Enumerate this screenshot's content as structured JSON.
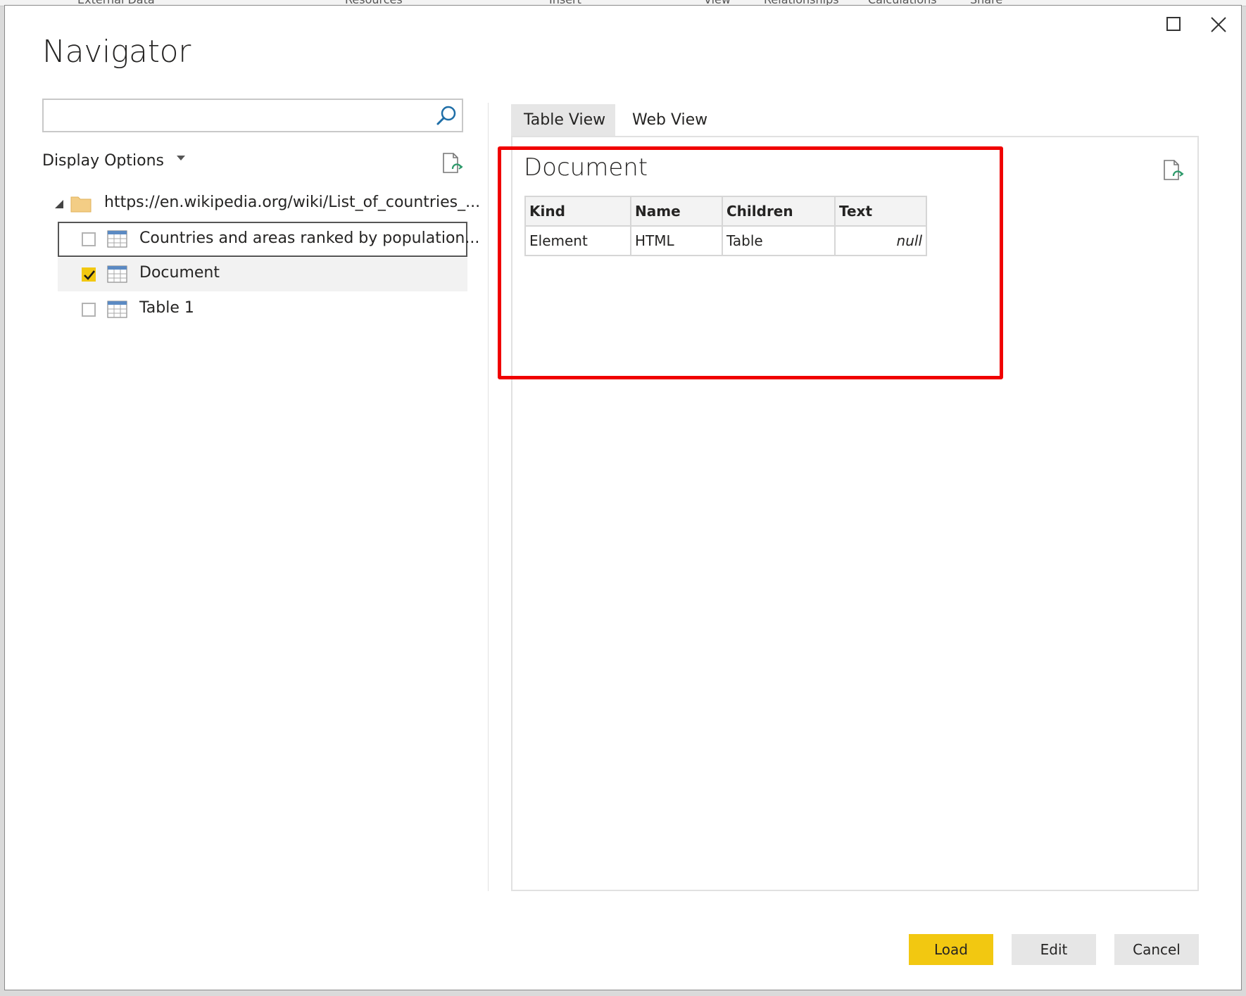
{
  "ribbon": {
    "tabs": [
      "External Data",
      "Resources",
      "Insert",
      "View",
      "Relationships",
      "Calculations",
      "Share"
    ]
  },
  "dialog": {
    "title": "Navigator",
    "maximize_icon": "maximize-icon",
    "close_icon": "close-icon"
  },
  "left_panel": {
    "search": {
      "value": "",
      "placeholder": "",
      "icon": "search-icon"
    },
    "display_options_label": "Display Options",
    "tree": {
      "root": {
        "label": "https://en.wikipedia.org/wiki/List_of_countries_...",
        "expanded": true,
        "icon": "folder-icon"
      },
      "items": [
        {
          "label": "Countries and areas ranked by population...",
          "checked": false,
          "focused": true,
          "selected": false
        },
        {
          "label": "Document",
          "checked": true,
          "focused": false,
          "selected": true
        },
        {
          "label": "Table 1",
          "checked": false,
          "focused": false,
          "selected": false
        }
      ]
    }
  },
  "right_panel": {
    "tabs": [
      {
        "label": "Table View",
        "active": true
      },
      {
        "label": "Web View",
        "active": false
      }
    ],
    "preview": {
      "title": "Document",
      "columns": [
        "Kind",
        "Name",
        "Children",
        "Text"
      ],
      "rows": [
        [
          "Element",
          "HTML",
          "Table",
          "null"
        ]
      ]
    }
  },
  "footer": {
    "load_label": "Load",
    "edit_label": "Edit",
    "cancel_label": "Cancel"
  },
  "colors": {
    "accent": "#f2c811",
    "highlight_box": "#f00000",
    "tab_active_bg": "#e6e6e6",
    "selected_row_bg": "#f2f2f2"
  }
}
